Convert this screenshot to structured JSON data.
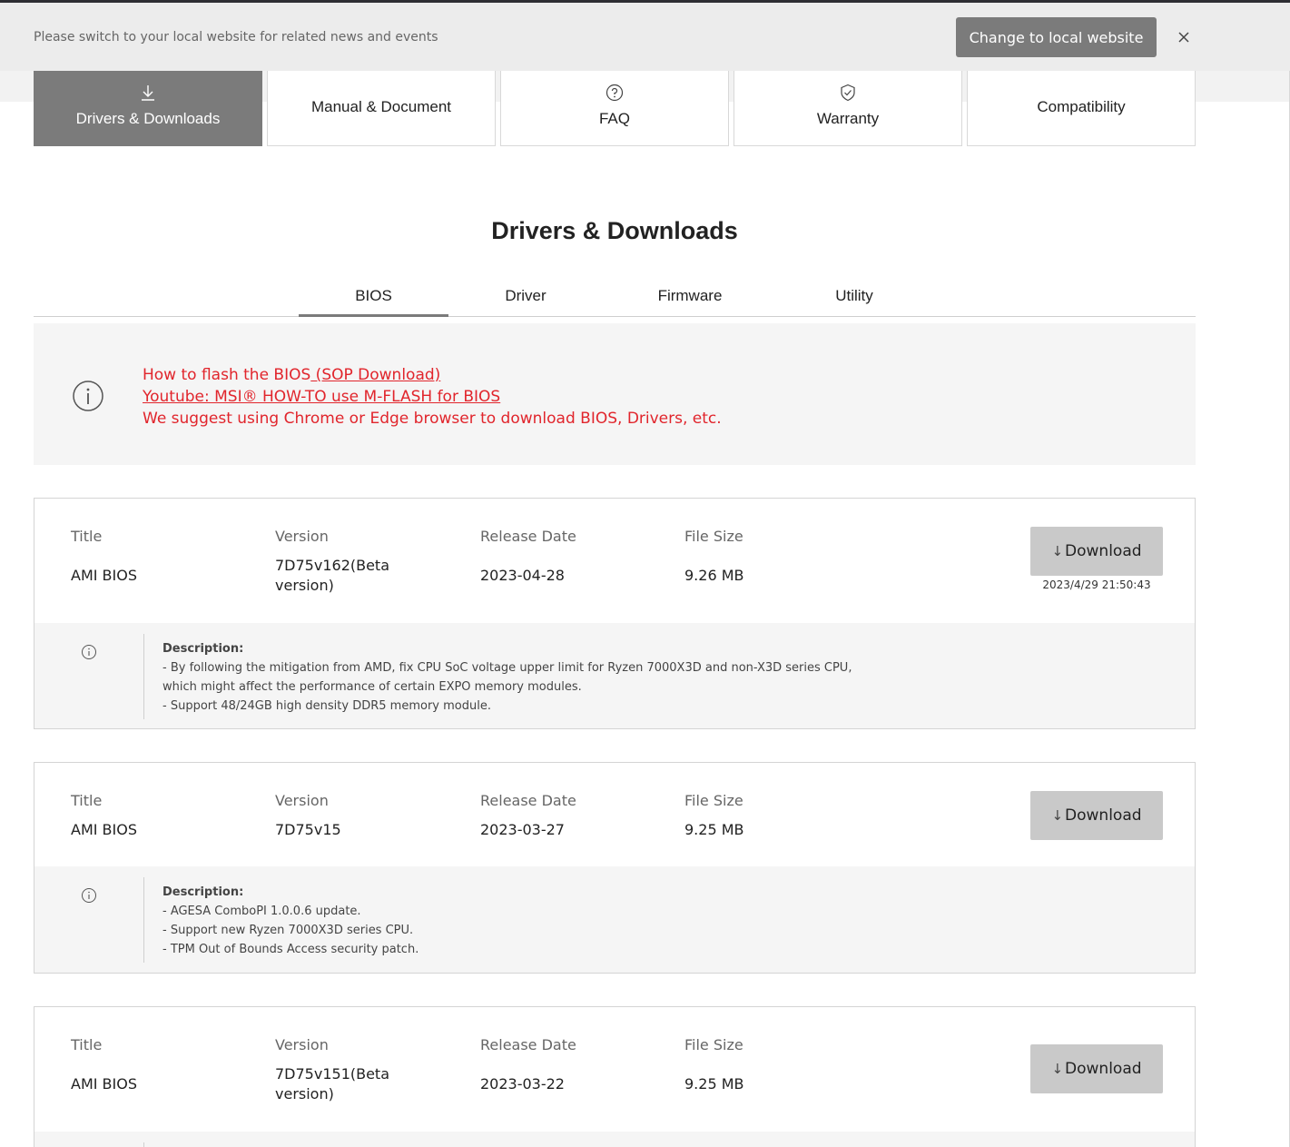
{
  "notice": {
    "text": "Please switch to your local website for related news and events",
    "button_label": "Change to local website"
  },
  "category_tabs": [
    {
      "label": "Drivers & Downloads",
      "icon": "download-icon",
      "active": true
    },
    {
      "label": "Manual & Document",
      "icon": "",
      "active": false
    },
    {
      "label": "FAQ",
      "icon": "question-circle-icon",
      "active": false
    },
    {
      "label": "Warranty",
      "icon": "shield-check-icon",
      "active": false
    },
    {
      "label": "Compatibility",
      "icon": "",
      "active": false
    }
  ],
  "section_title": "Drivers & Downloads",
  "sub_tabs": [
    {
      "label": "BIOS",
      "active": true
    },
    {
      "label": "Driver",
      "active": false
    },
    {
      "label": "Firmware",
      "active": false
    },
    {
      "label": "Utility",
      "active": false
    }
  ],
  "info": {
    "line1_text": "How to flash the BIOS",
    "line1_link": " (SOP Download)",
    "line2_link": "Youtube: MSI® HOW-TO use M-FLASH for BIOS",
    "line3_text": "We suggest using Chrome or Edge browser to download BIOS, Drivers, etc."
  },
  "columns": {
    "title": "Title",
    "version": "Version",
    "release_date": "Release Date",
    "file_size": "File Size"
  },
  "download_label": "Download",
  "description_heading": "Description:",
  "items": [
    {
      "title": "AMI BIOS",
      "version_line1": "7D75v162(Beta",
      "version_line2": "version)",
      "release_date": "2023-04-28",
      "file_size": "9.26 MB",
      "timestamp": "2023/4/29 21:50:43",
      "description": [
        "- By following the mitigation from AMD, fix CPU SoC voltage upper limit for Ryzen 7000X3D and non-X3D series CPU,",
        "which might affect the performance of certain EXPO memory modules.",
        "- Support 48/24GB high density DDR5 memory module."
      ]
    },
    {
      "title": "AMI BIOS",
      "version_line1": "7D75v15",
      "version_line2": "",
      "release_date": "2023-03-27",
      "file_size": "9.25 MB",
      "timestamp": "",
      "description": [
        "- AGESA ComboPI 1.0.0.6 update.",
        "- Support new Ryzen 7000X3D series CPU.",
        "- TPM Out of Bounds Access security patch."
      ]
    },
    {
      "title": "AMI BIOS",
      "version_line1": "7D75v151(Beta",
      "version_line2": "version)",
      "release_date": "2023-03-22",
      "file_size": "9.25 MB",
      "timestamp": "",
      "description": []
    }
  ]
}
